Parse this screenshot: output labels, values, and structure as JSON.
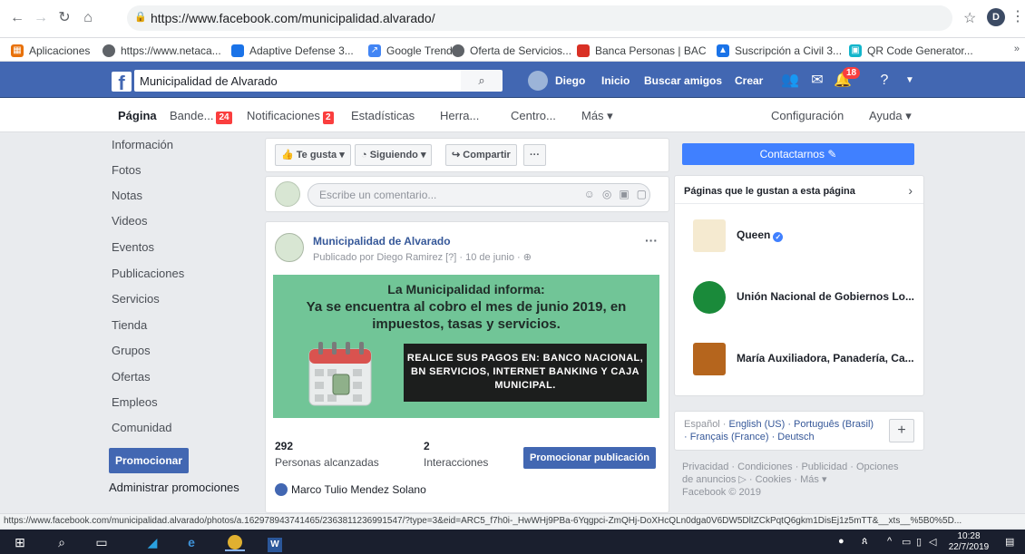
{
  "browser": {
    "url": "https://www.facebook.com/municipalidad.alvarado/",
    "profile_initial": "D",
    "bookmarks": [
      {
        "label": "Aplicaciones",
        "color": "#e8710a",
        "icon": "apps-grid-icon"
      },
      {
        "label": "https://www.netaca...",
        "color": "#5f6368",
        "icon": "globe-icon"
      },
      {
        "label": "Adaptive Defense 3...",
        "color": "#1a73e8",
        "icon": "shield-icon"
      },
      {
        "label": "Google Trends",
        "color": "#4285f4",
        "icon": "trend-icon"
      },
      {
        "label": "Oferta de Servicios...",
        "color": "#5f6368",
        "icon": "globe-icon"
      },
      {
        "label": "Banca Personas | BAC",
        "color": "#d93025",
        "icon": "bank-icon"
      },
      {
        "label": "Suscripción a Civil 3...",
        "color": "#1a73e8",
        "icon": "autodesk-icon"
      },
      {
        "label": "QR Code Generator...",
        "color": "#12b5cb",
        "icon": "qr-icon"
      }
    ],
    "status_url": "https://www.facebook.com/municipalidad.alvarado/photos/a.162978943741465/2363811236991547/?type=3&eid=ARC5_f7h0i-_HwWHj9PBa-6Yqgpci-ZmQHj-DoXHcQLn0dga0V6DW5DltZCkPqtQ6gkm1DisEj1z5mTT&__xts__%5B0%5D..."
  },
  "fb_header": {
    "search_value": "Municipalidad de Alvarado",
    "user_name": "Diego",
    "nav": [
      "Inicio",
      "Buscar amigos",
      "Crear"
    ],
    "notif_count": "18"
  },
  "page_tabs": {
    "items": [
      "Página",
      "Bande...",
      "Notificaciones",
      "Estadísticas",
      "Herra...",
      "Centro...",
      "Más ▾"
    ],
    "inbox_count": "24",
    "notif_count": "2",
    "right": [
      "Configuración",
      "Ayuda ▾"
    ]
  },
  "left_nav": {
    "items": [
      "Información",
      "Fotos",
      "Notas",
      "Videos",
      "Eventos",
      "Publicaciones",
      "Servicios",
      "Tienda",
      "Grupos",
      "Ofertas",
      "Empleos",
      "Comunidad"
    ],
    "promote_label": "Promocionar",
    "manage_promotions": "Administrar promociones"
  },
  "action_bar": {
    "like": "Te gusta ▾",
    "follow": "Siguiendo ▾",
    "share": "Compartir",
    "more": "···"
  },
  "composer": {
    "placeholder": "Escribe un comentario..."
  },
  "post": {
    "author": "Municipalidad de Alvarado",
    "meta": "Publicado por Diego Ramirez [?] · 10 de junio · ",
    "banner_title": "La Municipalidad informa:",
    "banner_text": "Ya se encuentra al cobro el mes de junio 2019, en impuestos, tasas y servicios.",
    "banner_box": "REALICE SUS PAGOS EN: BANCO NACIONAL, BN SERVICIOS, INTERNET BANKING Y CAJA MUNICIPAL.",
    "reach_num": "292",
    "reach_label": "Personas alcanzadas",
    "interactions_num": "2",
    "interactions_label": "Interacciones",
    "boost_label": "Promocionar publicación",
    "commenter": "Marco Tulio Mendez Solano"
  },
  "right_col": {
    "contact_label": "Contactarnos ✎",
    "likes_title": "Páginas que le gustan a esta página",
    "liked_pages": [
      {
        "name": "Queen",
        "verified": true,
        "color": "#c8a046"
      },
      {
        "name": "Unión Nacional de Gobiernos Lo...",
        "verified": false,
        "color": "#1a8a3a"
      },
      {
        "name": "María Auxiliadora, Panadería, Ca...",
        "verified": false,
        "color": "#a0522d"
      }
    ],
    "languages_primary": "Español · ",
    "languages_links": "English (US) · Português (Brasil) · Français (France) · Deutsch",
    "footer": "Privacidad · Condiciones · Publicidad · Opciones de anuncios ▷ · Cookies · Más ▾",
    "copyright": "Facebook © 2019"
  },
  "taskbar": {
    "time": "10:28",
    "date": "22/7/2019"
  }
}
